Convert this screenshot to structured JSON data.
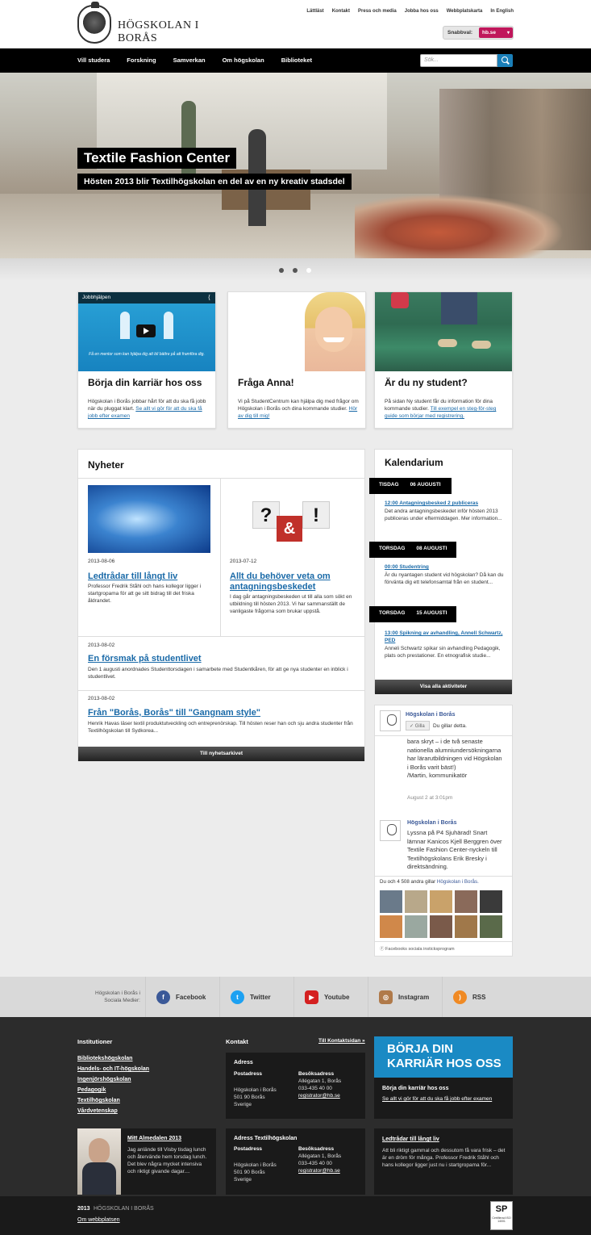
{
  "header": {
    "logo_text": "HÖGSKOLAN I BORÅS",
    "top_links": [
      "Lättläst",
      "Kontakt",
      "Press och media",
      "Jobba hos oss",
      "Webbplatskarta",
      "In English"
    ],
    "quick_label": "Snabbval:",
    "quick_value": "hb.se"
  },
  "nav": {
    "items": [
      "Vill studera",
      "Forskning",
      "Samverkan",
      "Om högskolan",
      "Biblioteket"
    ],
    "search_placeholder": "Sök..."
  },
  "hero": {
    "title": "Textile Fashion Center",
    "subtitle": "Hösten 2013 blir Textilhögskolan en del av en ny kreativ stadsdel",
    "slides": 3,
    "active_slide": 3
  },
  "cards": [
    {
      "video_label": "Jobbhjälpen",
      "video_caption": "Få en mentor som kan hjälpa dig att bli bättre på att framföra dig.",
      "title": "Börja din karriär hos oss",
      "text": "Högskolan i Borås jobbar hårt för att du ska få jobb när du pluggat klart.",
      "link": "Se allt vi gör för att du ska få jobb efter examen"
    },
    {
      "title": "Fråga Anna!",
      "text": "Vi på StudentCentrum kan hjälpa dig med frågor om Högskolan i Borås och dina kommande studier.",
      "link": "Hör av dig till mig!"
    },
    {
      "title": "Är du ny student?",
      "text": "På sidan Ny student får du information för dina kommande studier.",
      "link": "Till exempel en steg-för-steg guide som börjar med registrering."
    }
  ],
  "news": {
    "heading": "Nyheter",
    "items": [
      {
        "date": "2013-08-06",
        "title": "Ledtrådar till långt liv",
        "text": "Professor Fredrik Ståhl och hans kollegor ligger i startgropama för att ge sitt bidrag till det friska åldrandet."
      },
      {
        "date": "2013-07-12",
        "title": "Allt du behöver veta om antagningsbeskedet",
        "text": "I dag går antagningsbeskeden ut till alla som sökt en utbildning till hösten 2013. Vi har sammanställt de vanligaste frågorna som brukar uppstå."
      },
      {
        "date": "2013-08-02",
        "title": "En försmak på studentlivet",
        "text": "Den 1 augusti anordnades Studenttorsdagen i samarbete med Studentkåren, för att ge nya studenter en inblick i studentlivet."
      },
      {
        "date": "2013-08-02",
        "title": "Från \"Borås, Borås\" till \"Gangnam style\"",
        "text": "Henrik Havas läser textil produktutveckling och entreprenörskap. Till hösten reser han och sju andra studenter från Textilhögskolan till Sydkorea..."
      }
    ],
    "archive_button": "Till nyhetsarkivet"
  },
  "calendar": {
    "heading": "Kalendarium",
    "events": [
      {
        "weekday": "TISDAG",
        "date": "06 AUGUSTI",
        "title": "12:00 Antagningsbesked 2 publiceras",
        "text": "Det andra antagningsbeskedet inför hösten 2013 publiceras under eftermiddagen. Mer information..."
      },
      {
        "weekday": "TORSDAG",
        "date": "08 AUGUSTI",
        "title": "00:00 Studentring",
        "text": "Är du nyantagen student vid högskolan? Då kan du förvänta dig ett telefonsamtal från en student..."
      },
      {
        "weekday": "TORSDAG",
        "date": "15 AUGUSTI",
        "title": "13:00 Spikning av avhandling, Annell Schwartz, PED",
        "text": "Anneli Schwartz spikar sin avhandling Pedagogik, plats och prestationer. En etnografisk studie..."
      }
    ],
    "all_button": "Visa alla aktiviteter"
  },
  "facebook": {
    "page_name": "Högskolan i Borås",
    "like_button": "Gilla",
    "like_status": "Du gillar detta.",
    "post1_text": "bara skryt – i de två senaste nationella alumniundersökningarna har lärarutbildningen vid Högskolan i Borås varit bäst!)\n/Martin, kommunikatör",
    "post1_time": "August 2 at 3:01pm",
    "post2_name": "Högskolan i Borås",
    "post2_text": "Lyssna på P4 Sjuhärad! Snart lämnar Kanicos Kjell Berggren över Textile Fashion Center-nyckeln till Textilhögskolans Erik Bresky i direktsändning.",
    "likes_prefix": "Du och 4 508 andra gillar ",
    "likes_link": "Högskolan i Borås.",
    "plugin": "Facebooks sociala insticksprogram"
  },
  "social": {
    "label": "Högskolan i Borås i Sociala Medier:",
    "items": [
      "Facebook",
      "Twitter",
      "Youtube",
      "Instagram",
      "RSS"
    ]
  },
  "footer": {
    "inst_heading": "Institutioner",
    "institutions": [
      "Bibliotekshögskolan",
      "Handels- och IT-högskolan",
      "Ingenjörshögskolan",
      "Pedagogik",
      "Textilhögskolan",
      "Vårdvetenskap"
    ],
    "contact_heading": "Kontakt",
    "contact_link": "Till Kontaktsidan »",
    "address1": {
      "heading": "Adress",
      "post_label": "Postadress",
      "post": "Högskolan i Borås\n501 90 Borås\nSverige",
      "visit_label": "Besöksadress",
      "visit": "Allégatan 1, Borås\n033-435 40 00",
      "email": "registrator@hb.se"
    },
    "address2": {
      "heading": "Adress Textilhögskolan",
      "post_label": "Postadress",
      "post": "Högskolan i Borås\n501 90 Borås\nSverige",
      "visit_label": "Besöksadress",
      "visit": "Allégatan 1, Borås\n033-435 40 00",
      "email": "registrator@hb.se"
    },
    "banner_title": "BÖRJA DIN KARRIÄR HOS OSS",
    "banner_sub": "Börja din karriär hos oss",
    "banner_link": "Se allt vi gör för att du ska få jobb efter examen",
    "blog_title": "Mitt Almedalen 2013",
    "blog_text": "Jag anlände till Visby tisdag lunch och återvände hem torsdag lunch. Det blev några mycket intensiva och riktigt givande dagar....",
    "news_title": "Ledtrådar till långt liv",
    "news_text": "Att bli riktigt gammal och dessutom få vara frisk – det är en dröm för många. Professor Fredrik Ståhl och hans kollegor ligger just nu i startgropama för..."
  },
  "bottom": {
    "year": "2013",
    "org": "HÖGSKOLAN I BORÅS",
    "about_link": "Om webbplatsen",
    "cert_top": "SP",
    "cert_text": "Certifierad ISO 14001"
  }
}
